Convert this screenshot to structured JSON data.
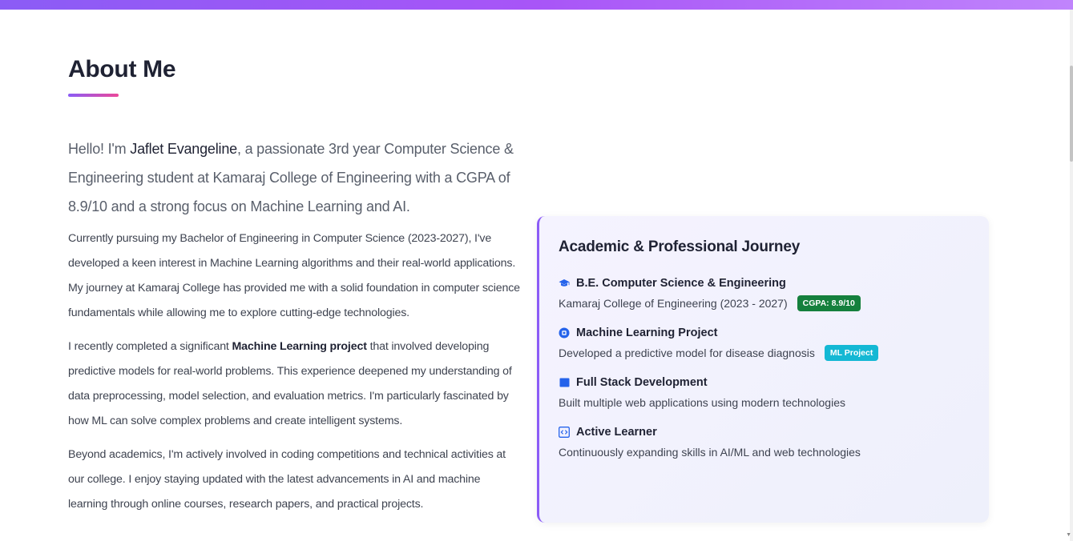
{
  "section": {
    "title": "About Me"
  },
  "about": {
    "lead_prefix": "Hello! I'm ",
    "lead_name": "Jaflet Evangeline",
    "lead_suffix": ", a passionate 3rd year Computer Science & Engineering student at Kamaraj College of Engineering with a CGPA of 8.9/10 and a strong focus on Machine Learning and AI.",
    "para1": "Currently pursuing my Bachelor of Engineering in Computer Science (2023-2027), I've developed a keen interest in Machine Learning algorithms and their real-world applications. My journey at Kamaraj College has provided me with a solid foundation in computer science fundamentals while allowing me to explore cutting-edge technologies.",
    "para2_prefix": "I recently completed a significant ",
    "para2_bold": "Machine Learning project",
    "para2_suffix": " that involved developing predictive models for real-world problems. This experience deepened my understanding of data preprocessing, model selection, and evaluation metrics. I'm particularly fascinated by how ML can solve complex problems and create intelligent systems.",
    "para3": "Beyond academics, I'm actively involved in coding competitions and technical activities at our college. I enjoy staying updated with the latest advancements in AI and machine learning through online courses, research papers, and practical projects."
  },
  "journey": {
    "title": "Academic & Professional Journey",
    "items": [
      {
        "icon": "graduation-cap-icon",
        "title": "B.E. Computer Science & Engineering",
        "desc": "Kamaraj College of Engineering (2023 - 2027)",
        "badge": "CGPA: 8.9/10"
      },
      {
        "icon": "robot-icon",
        "title": "Machine Learning Project",
        "desc": "Developed a predictive model for disease diagnosis",
        "badge": "ML Project"
      },
      {
        "icon": "laptop-icon",
        "title": "Full Stack Development",
        "desc": "Built multiple web applications using modern technologies"
      },
      {
        "icon": "code-icon",
        "title": "Active Learner",
        "desc": "Continuously expanding skills in AI/ML and web technologies"
      }
    ]
  },
  "colors": {
    "accent": "#8b5cf6",
    "pink": "#ec4899",
    "icon_blue": "#2563eb",
    "badge_green": "#15803d",
    "badge_teal": "#14b8d4"
  }
}
